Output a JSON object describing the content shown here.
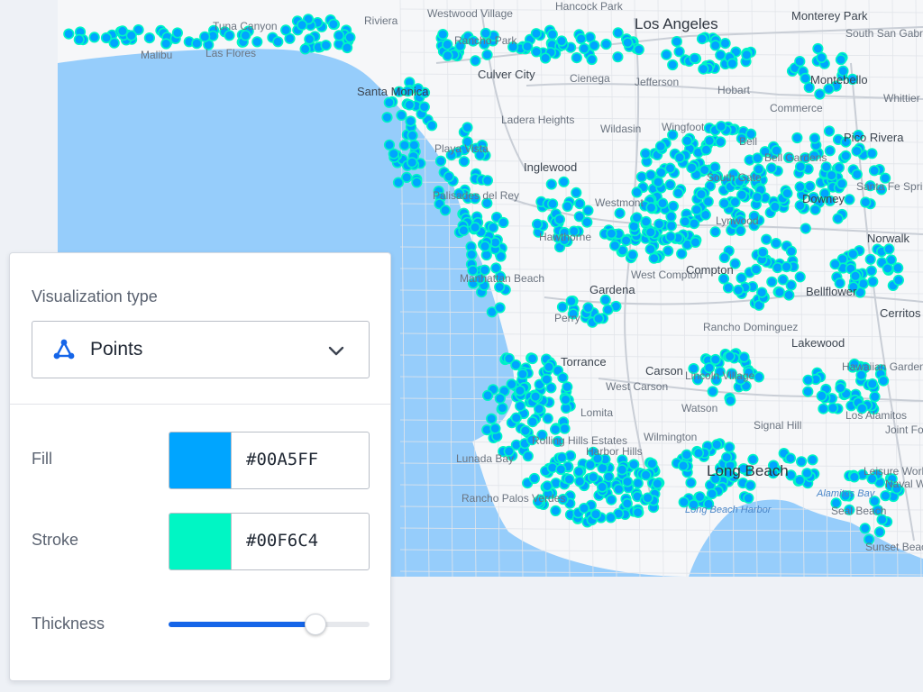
{
  "map": {
    "labels": [
      {
        "text": "Los Angeles",
        "cls": "major"
      },
      {
        "text": "Culver City",
        "cls": "city"
      },
      {
        "text": "Santa Monica",
        "cls": "city"
      },
      {
        "text": "Inglewood",
        "cls": "city"
      },
      {
        "text": "Downey",
        "cls": "city"
      },
      {
        "text": "Norwalk",
        "cls": "city"
      },
      {
        "text": "Compton",
        "cls": "city"
      },
      {
        "text": "Gardena",
        "cls": "city"
      },
      {
        "text": "Torrance",
        "cls": "city"
      },
      {
        "text": "Carson",
        "cls": "city"
      },
      {
        "text": "Lakewood",
        "cls": "city"
      },
      {
        "text": "Long Beach",
        "cls": "major"
      },
      {
        "text": "Bellflower",
        "cls": "city"
      },
      {
        "text": "Cerritos",
        "cls": "city"
      },
      {
        "text": "Pico Rivera",
        "cls": "city"
      },
      {
        "text": "Montebello",
        "cls": "city"
      },
      {
        "text": "Monterey Park",
        "cls": "city"
      },
      {
        "text": "Malibu",
        "cls": ""
      },
      {
        "text": "Las Flores",
        "cls": ""
      },
      {
        "text": "Tuna Canyon",
        "cls": ""
      },
      {
        "text": "Riviera",
        "cls": ""
      },
      {
        "text": "Westwood Village",
        "cls": ""
      },
      {
        "text": "Rancho Park",
        "cls": ""
      },
      {
        "text": "Hancock Park",
        "cls": ""
      },
      {
        "text": "Cienega",
        "cls": ""
      },
      {
        "text": "Jefferson",
        "cls": ""
      },
      {
        "text": "Ladera Heights",
        "cls": ""
      },
      {
        "text": "Wildasin",
        "cls": ""
      },
      {
        "text": "Wingfoot",
        "cls": ""
      },
      {
        "text": "Hobart",
        "cls": ""
      },
      {
        "text": "Commerce",
        "cls": ""
      },
      {
        "text": "Bell",
        "cls": ""
      },
      {
        "text": "Bell Gardens",
        "cls": ""
      },
      {
        "text": "South Gate",
        "cls": ""
      },
      {
        "text": "Lynwood",
        "cls": ""
      },
      {
        "text": "Westmont",
        "cls": ""
      },
      {
        "text": "Hawthorne",
        "cls": ""
      },
      {
        "text": "West Compton",
        "cls": ""
      },
      {
        "text": "Playa Vista",
        "cls": ""
      },
      {
        "text": "Palisades del Rey",
        "cls": ""
      },
      {
        "text": "Manhattan Beach",
        "cls": ""
      },
      {
        "text": "Perry",
        "cls": ""
      },
      {
        "text": "Rancho Dominguez",
        "cls": ""
      },
      {
        "text": "West Carson",
        "cls": ""
      },
      {
        "text": "Lincoln Village",
        "cls": ""
      },
      {
        "text": "Lomita",
        "cls": ""
      },
      {
        "text": "Watson",
        "cls": ""
      },
      {
        "text": "Wilmington",
        "cls": ""
      },
      {
        "text": "Signal Hill",
        "cls": ""
      },
      {
        "text": "Harbor Hills",
        "cls": ""
      },
      {
        "text": "Rolling Hills Estates",
        "cls": ""
      },
      {
        "text": "Lunada Bay",
        "cls": ""
      },
      {
        "text": "Rancho Palos Verdes",
        "cls": ""
      },
      {
        "text": "Long Beach Harbor",
        "cls": "water"
      },
      {
        "text": "Hawaiian Gardens",
        "cls": ""
      },
      {
        "text": "Los Alamitos",
        "cls": ""
      },
      {
        "text": "Joint Forces Training Center",
        "cls": ""
      },
      {
        "text": "Leisure World",
        "cls": ""
      },
      {
        "text": "Alamitos Bay",
        "cls": "water"
      },
      {
        "text": "Naval Weapons Station Seal Beach",
        "cls": ""
      },
      {
        "text": "Seal Beach",
        "cls": ""
      },
      {
        "text": "Sunset Beach",
        "cls": ""
      },
      {
        "text": "South San Gabriel",
        "cls": ""
      },
      {
        "text": "Whittier",
        "cls": ""
      },
      {
        "text": "Santa Fe Springs",
        "cls": ""
      }
    ]
  },
  "panel": {
    "viz_label": "Visualization type",
    "viz_value": "Points",
    "fill_label": "Fill",
    "fill_hex": "#00A5FF",
    "stroke_label": "Stroke",
    "stroke_hex": "#00F6C4",
    "thickness_label": "Thickness",
    "thickness_value": 0.73
  },
  "colors": {
    "point_fill": "#00A5FF",
    "point_stroke": "#00F6C4",
    "ocean": "#96cdfb",
    "land": "#f6f7f9",
    "accent": "#1565e8"
  }
}
